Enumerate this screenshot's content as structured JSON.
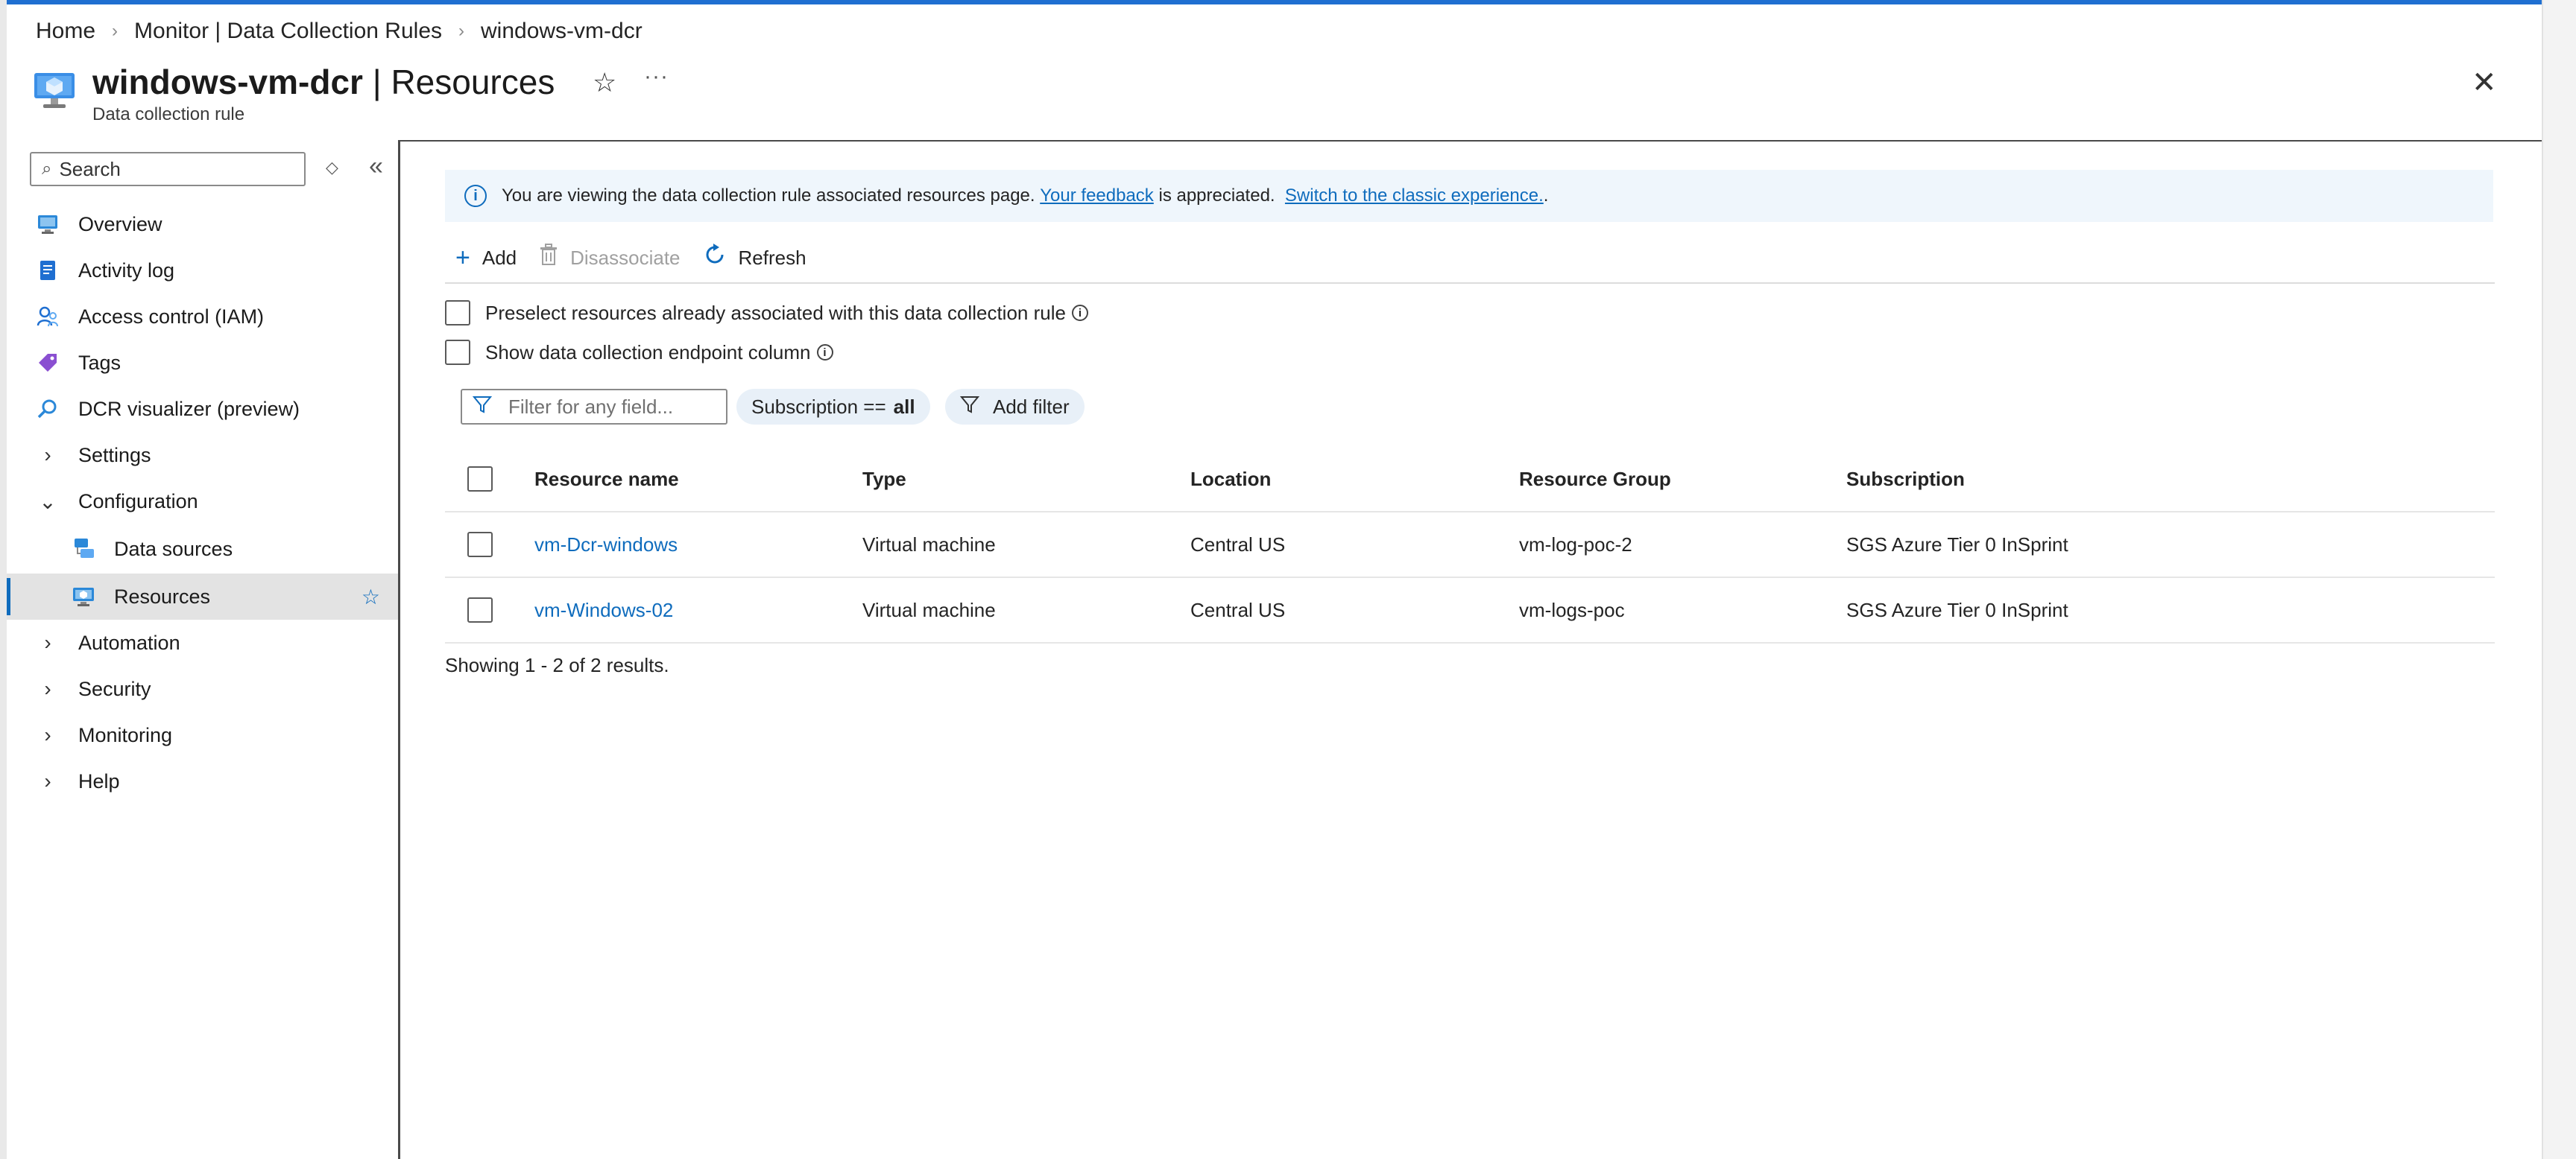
{
  "breadcrumb": {
    "items": [
      "Home",
      "Monitor | Data Collection Rules",
      "windows-vm-dcr"
    ],
    "separator": "›"
  },
  "header": {
    "title_name": "windows-vm-dcr",
    "title_sep": " | ",
    "title_page": "Resources",
    "subtitle": "Data collection rule",
    "favorite_icon": "☆",
    "more_icon": "···",
    "close_icon": "✕"
  },
  "sidebar": {
    "search_placeholder": "Search",
    "items": [
      {
        "label": "Overview",
        "icon": "overview-icon"
      },
      {
        "label": "Activity log",
        "icon": "activity-log-icon"
      },
      {
        "label": "Access control (IAM)",
        "icon": "iam-icon"
      },
      {
        "label": "Tags",
        "icon": "tag-icon"
      },
      {
        "label": "DCR visualizer (preview)",
        "icon": "visualizer-icon"
      },
      {
        "label": "Settings",
        "icon": "chevron-right-icon"
      },
      {
        "label": "Configuration",
        "icon": "chevron-down-icon"
      },
      {
        "label": "Data sources",
        "icon": "data-sources-icon"
      },
      {
        "label": "Resources",
        "icon": "resources-icon",
        "active": true
      },
      {
        "label": "Automation",
        "icon": "chevron-right-icon"
      },
      {
        "label": "Security",
        "icon": "chevron-right-icon"
      },
      {
        "label": "Monitoring",
        "icon": "chevron-right-icon"
      },
      {
        "label": "Help",
        "icon": "chevron-right-icon"
      }
    ]
  },
  "infobar": {
    "text_before": "You are viewing the data collection rule associated resources page.",
    "feedback_link": "Your feedback",
    "text_middle": "is appreciated.",
    "classic_link": "Switch to the classic experience.",
    "text_after": "."
  },
  "commands": {
    "add": "Add",
    "disassociate": "Disassociate",
    "refresh": "Refresh"
  },
  "options": {
    "preselect": "Preselect resources already associated with this data collection rule",
    "show_endpoint": "Show data collection endpoint column"
  },
  "filters": {
    "placeholder": "Filter for any field...",
    "subscription_label": "Subscription ==",
    "subscription_value": "all",
    "add_filter": "Add filter"
  },
  "table": {
    "columns": [
      "Resource name",
      "Type",
      "Location",
      "Resource Group",
      "Subscription"
    ],
    "rows": [
      [
        "vm-Dcr-windows",
        "Virtual machine",
        "Central US",
        "vm-log-poc-2",
        "SGS Azure Tier 0 InSprint"
      ],
      [
        "vm-Windows-02",
        "Virtual machine",
        "Central US",
        "vm-logs-poc",
        "SGS Azure Tier 0 InSprint"
      ]
    ],
    "results_text": "Showing 1 - 2 of 2 results."
  },
  "colors": {
    "accent": "#0f6cbd",
    "topbar": "#1f6fd1",
    "info_bg": "#eff6fc"
  }
}
